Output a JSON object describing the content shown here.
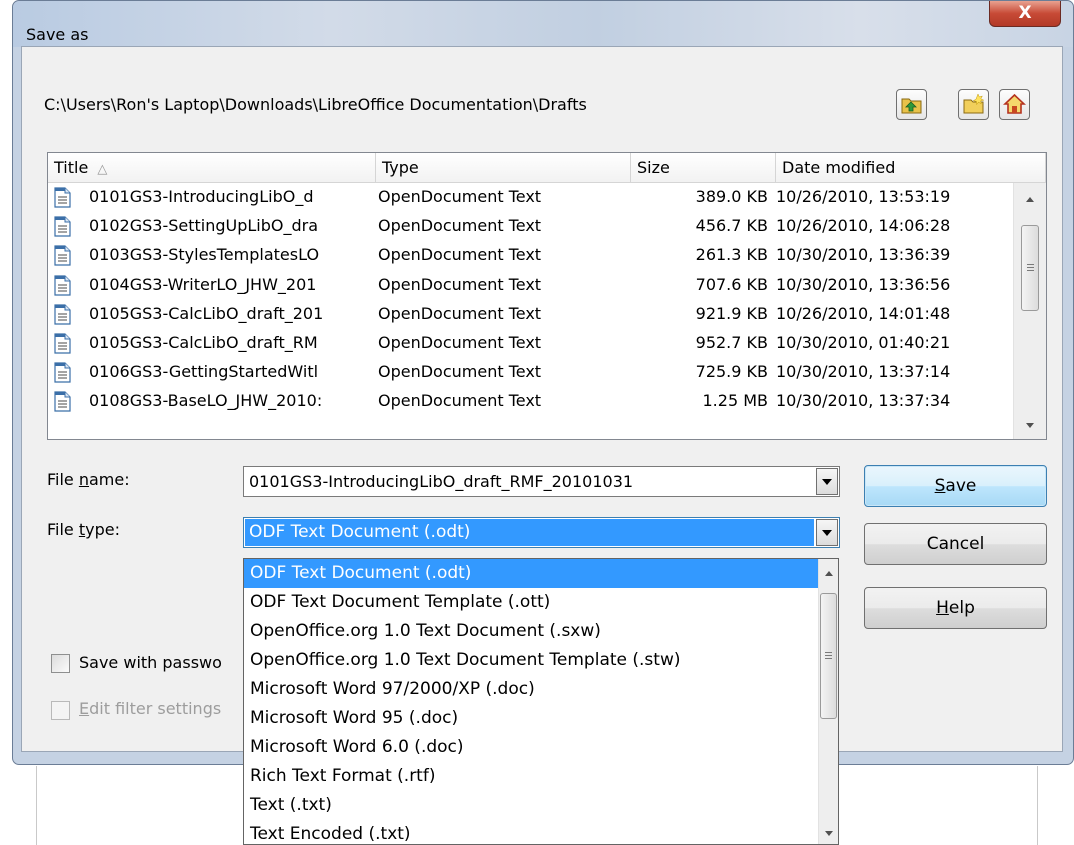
{
  "dialog": {
    "title": "Save as",
    "close_label": "X",
    "path": "C:\\Users\\Ron's Laptop\\Downloads\\LibreOffice Documentation\\Drafts",
    "toolbar_icons": [
      "up-one-level-icon",
      "create-new-folder-icon",
      "home-icon"
    ]
  },
  "file_list": {
    "columns": [
      "Title",
      "Type",
      "Size",
      "Date modified"
    ],
    "sort_indicator": "△",
    "rows": [
      {
        "title": "0101GS3-IntroducingLibO_d",
        "type": "OpenDocument Text",
        "size": "389.0 KB",
        "date": "10/26/2010, 13:53:19"
      },
      {
        "title": "0102GS3-SettingUpLibO_dra",
        "type": "OpenDocument Text",
        "size": "456.7 KB",
        "date": "10/26/2010, 14:06:28"
      },
      {
        "title": "0103GS3-StylesTemplatesLO",
        "type": "OpenDocument Text",
        "size": "261.3 KB",
        "date": "10/30/2010, 13:36:39"
      },
      {
        "title": "0104GS3-WriterLO_JHW_201",
        "type": "OpenDocument Text",
        "size": "707.6 KB",
        "date": "10/30/2010, 13:36:56"
      },
      {
        "title": "0105GS3-CalcLibO_draft_201",
        "type": "OpenDocument Text",
        "size": "921.9 KB",
        "date": "10/26/2010, 14:01:48"
      },
      {
        "title": "0105GS3-CalcLibO_draft_RM",
        "type": "OpenDocument Text",
        "size": "952.7 KB",
        "date": "10/30/2010, 01:40:21"
      },
      {
        "title": "0106GS3-GettingStartedWitl",
        "type": "OpenDocument Text",
        "size": "725.9 KB",
        "date": "10/30/2010, 13:37:14"
      },
      {
        "title": "0108GS3-BaseLO_JHW_2010:",
        "type": "OpenDocument Text",
        "size": "1.25 MB",
        "date": "10/30/2010, 13:37:34"
      }
    ]
  },
  "form": {
    "file_name_label_pre": "File ",
    "file_name_label_acc": "n",
    "file_name_label_post": "ame:",
    "file_name_value": "0101GS3-IntroducingLibO_draft_RMF_20101031",
    "file_type_label_pre": "File ",
    "file_type_label_acc": "t",
    "file_type_label_post": "ype:",
    "file_type_value": "ODF Text Document (.odt)",
    "save_with_password": "Save with passwo",
    "edit_filter_acc": "E",
    "edit_filter_rest": "dit filter settings"
  },
  "buttons": {
    "save_acc": "S",
    "save_rest": "ave",
    "cancel": "Cancel",
    "help_acc": "H",
    "help_rest": "elp"
  },
  "file_type_options": [
    "ODF Text Document (.odt)",
    "ODF Text Document Template (.ott)",
    "OpenOffice.org 1.0 Text Document (.sxw)",
    "OpenOffice.org 1.0 Text Document Template (.stw)",
    "Microsoft Word 97/2000/XP (.doc)",
    "Microsoft Word 95 (.doc)",
    "Microsoft Word 6.0 (.doc)",
    "Rich Text Format (.rtf)",
    "Text (.txt)",
    "Text Encoded (.txt)"
  ],
  "selected_file_type_index": 0,
  "colors": {
    "selection": "#3399ff",
    "dialog_frame": "#c5d2e3"
  }
}
